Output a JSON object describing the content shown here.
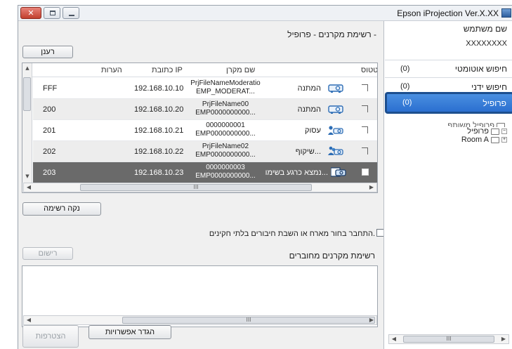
{
  "titlebar": {
    "title": "Epson iProjection Ver.X.XX",
    "close_glyph": "✕"
  },
  "right_panel": {
    "user_name_label": "שם משתמש",
    "user_name_value": "XXXXXXXX",
    "items": [
      {
        "label": "חיפוש אוטומטי",
        "count": "(0)"
      },
      {
        "label": "חיפוש ידני",
        "count": "(0)"
      },
      {
        "label": "פרופיל",
        "count": "(0)"
      }
    ],
    "tree": {
      "top_partial": "פרופיל משותף",
      "node1": "פרופיל",
      "node2": "Room A"
    },
    "scroll_thumb": "III"
  },
  "main": {
    "list_title": "רשימת מקרנים - פרופיל -",
    "refresh_label": "רענן",
    "columns": {
      "status": "סטטוס",
      "name": "שם מקרן",
      "ip": "כתובת IP",
      "notes": "הערות"
    },
    "rows": [
      {
        "notes": "FFF",
        "ip": "192.168.10.10",
        "name1": "PrjFileNameModeratio",
        "name2": "EMP_MODERAT...",
        "status": "המתנה",
        "icon": "projector-icon"
      },
      {
        "notes": "200",
        "ip": "192.168.10.20",
        "name1": "PrjFileName00",
        "name2": "EMP0000000000...",
        "status": "המתנה",
        "icon": "projector-icon"
      },
      {
        "notes": "201",
        "ip": "192.168.10.21",
        "name1": "0000000001",
        "name2": "EMP0000000000...",
        "status": "עסוק",
        "icon": "projector-user-icon"
      },
      {
        "notes": "202",
        "ip": "192.168.10.22",
        "name1": "PrjFileName02",
        "name2": "EMP0000000000...",
        "status": "שיקוף...",
        "icon": "projector-users-icon"
      },
      {
        "notes": "203",
        "ip": "192.168.10.23",
        "name1": "0000000003",
        "name2": "EMP0000000000...",
        "status": "נמצא כרגע בשימו...",
        "icon": "projector-display-icon"
      }
    ],
    "grid_scroll_thumb": "III",
    "clear_list_label": "נקה רשימה",
    "interrupt_text": "התחבר בחור מארח או השבת חיבורים בלתי חקינים.",
    "register_label": "רישום",
    "connected_title": "רשימת מקרנים מחוברים",
    "list2_scroll_thumb": "III",
    "set_options_label": "הגדר אפשרויות",
    "join_label": "הצטרפות"
  },
  "colors": {
    "selection_blue": "#2b6fd0",
    "selected_row": "#6a6a6a"
  }
}
